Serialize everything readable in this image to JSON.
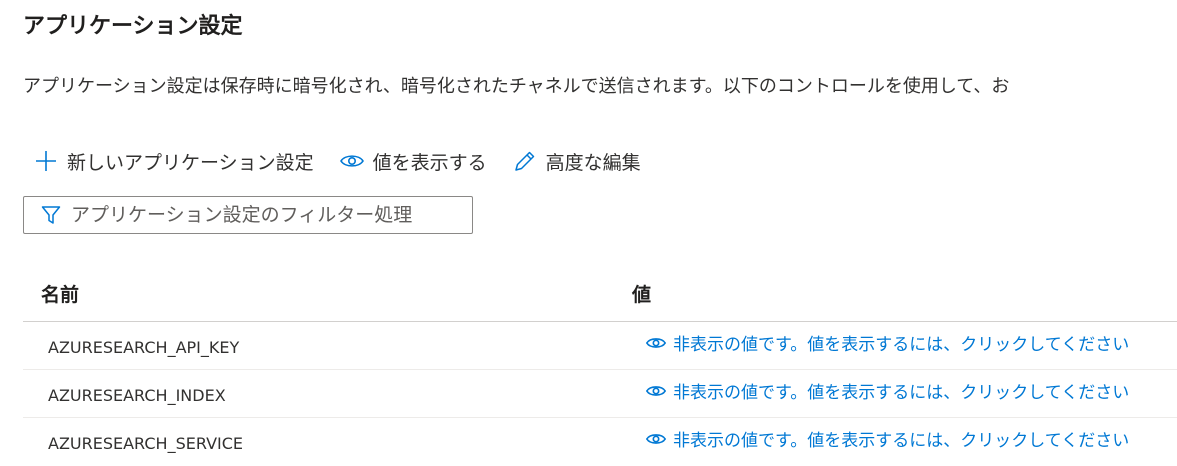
{
  "section": {
    "title": "アプリケーション設定",
    "description": "アプリケーション設定は保存時に暗号化され、暗号化されたチャネルで送信されます。以下のコントロールを使用して、お"
  },
  "toolbar": {
    "new_setting_label": "新しいアプリケーション設定",
    "show_values_label": "値を表示する",
    "advanced_edit_label": "高度な編集"
  },
  "filter": {
    "placeholder": "アプリケーション設定のフィルター処理",
    "value": ""
  },
  "table": {
    "columns": {
      "name": "名前",
      "value": "値"
    },
    "rows": [
      {
        "name": "AZURESEARCH_API_KEY",
        "value": "非表示の値です。値を表示するには、クリックしてください"
      },
      {
        "name": "AZURESEARCH_INDEX",
        "value": "非表示の値です。値を表示するには、クリックしてください"
      },
      {
        "name": "AZURESEARCH_SERVICE",
        "value": "非表示の値です。値を表示するには、クリックしてください"
      }
    ]
  },
  "icons": {
    "add": "add-icon",
    "eye": "eye-icon",
    "edit": "pencil-icon",
    "filter": "filter-icon"
  },
  "colors": {
    "accent": "#0078d4",
    "text": "#323130",
    "border": "#8a8886"
  }
}
